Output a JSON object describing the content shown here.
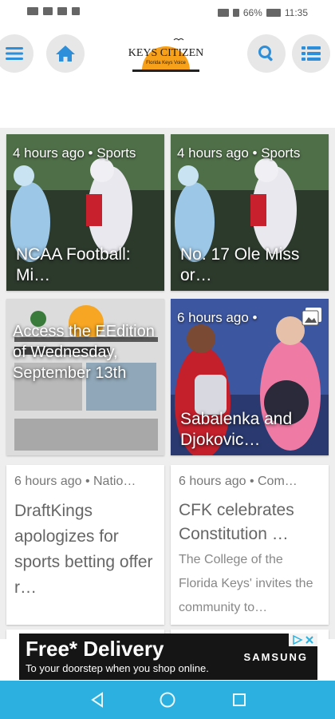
{
  "status_bar": {
    "battery": "66%",
    "time": "11:35"
  },
  "header": {
    "logo_text": "KEYS CITIZEN",
    "logo_subtext": "Florida Keys Voice"
  },
  "cards": [
    {
      "type": "image",
      "meta": "4 hours ago • Sports",
      "title": "NCAA Football: Mi…",
      "colors": [
        "#4a6a3a",
        "#1d2a20"
      ]
    },
    {
      "type": "image",
      "meta": "4 hours ago • Sports",
      "title": "No. 17 Ole Miss or…",
      "colors": [
        "#4a6a3a",
        "#1d2a20"
      ]
    },
    {
      "type": "image",
      "meta": "",
      "title": "Access the EEdition of Wednesday, September 13th",
      "colors": [
        "#d8d8d8",
        "#9aa8b4"
      ]
    },
    {
      "type": "image",
      "meta": "6 hours ago •",
      "title": "Sabalenka and Djokovic…",
      "colors": [
        "#3a4a8a",
        "#a6b8d8"
      ]
    },
    {
      "type": "text",
      "meta": "6 hours ago • Natio…",
      "title": "DraftKings apologizes for sports betting offer r…",
      "desc": ""
    },
    {
      "type": "text",
      "meta": "6 hours ago • Com…",
      "title": "CFK celebrates Constitution …",
      "desc": "The College of the Florida Keys' invites the community to…"
    }
  ],
  "ad": {
    "title": "Free* Delivery",
    "subtitle": "To your doorstep when you shop online.",
    "brand": "SAMSUNG"
  }
}
